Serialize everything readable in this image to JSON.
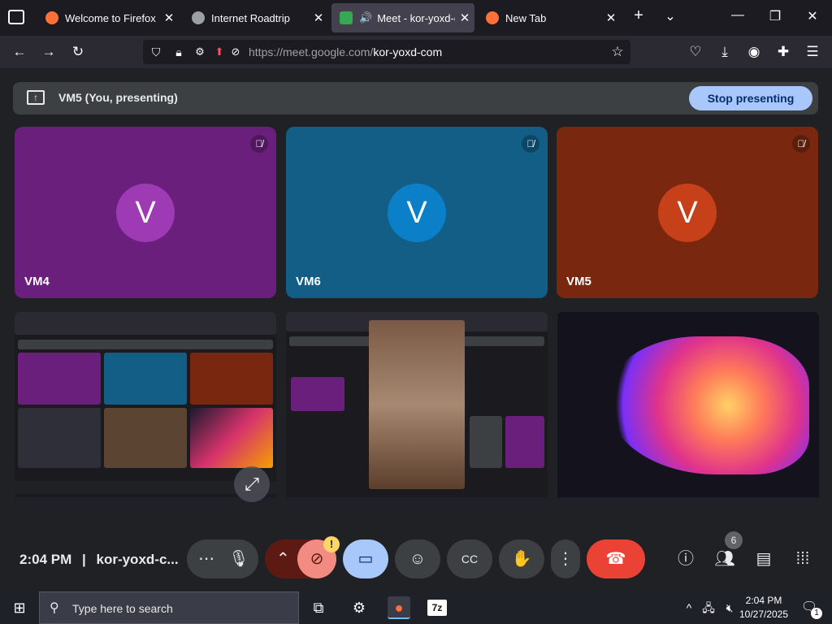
{
  "tabs": [
    {
      "title": "Welcome to Firefox",
      "color": "#ff7139"
    },
    {
      "title": "Internet Roadtrip",
      "color": "#9aa0a6"
    },
    {
      "title": "Meet - kor-yoxd-com",
      "color": "#34a853",
      "active": true
    },
    {
      "title": "New Tab",
      "color": "#ff7139"
    }
  ],
  "browser": {
    "url_host": "https://meet.google.com/",
    "url_path": "kor-yoxd-com"
  },
  "meet": {
    "presenting_label": "VM5 (You, presenting)",
    "stop_presenting": "Stop presenting",
    "participants": [
      {
        "name": "VM4",
        "initial": "V",
        "bg": "#6b1f7c",
        "avatar": "#9f3ab5"
      },
      {
        "name": "VM6",
        "initial": "V",
        "bg": "#125e86",
        "avatar": "#0b80c8"
      },
      {
        "name": "VM5",
        "initial": "V",
        "bg": "#7a2710",
        "avatar": "#c6401a"
      }
    ],
    "time": "2:04 PM",
    "separator": "|",
    "meeting_code": "kor-yoxd-c...",
    "people_count": "6",
    "camera_warning": "!"
  },
  "taskbar": {
    "search_placeholder": "Type here to search",
    "time": "2:04 PM",
    "date": "10/27/2025",
    "notif_count": "1"
  }
}
